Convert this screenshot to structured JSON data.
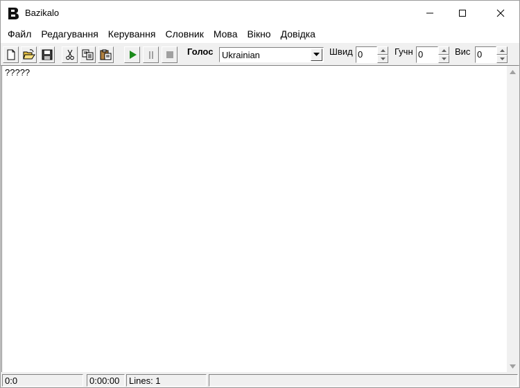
{
  "window": {
    "title": "Bazikalo"
  },
  "menu": {
    "items": [
      "Файл",
      "Редагування",
      "Керування",
      "Словник",
      "Мова",
      "Вікно",
      "Довідка"
    ]
  },
  "toolbar": {
    "voice_label": "Голос",
    "voice_selected": "Ukrainian",
    "speed_label": "Швид",
    "speed_value": "0",
    "volume_label": "Гучн",
    "volume_value": "0",
    "pitch_label": "Вис",
    "pitch_value": "0",
    "icons": [
      "new-file-icon",
      "open-folder-icon",
      "save-icon",
      "cut-icon",
      "copy-icon",
      "paste-icon",
      "play-icon",
      "pause-icon",
      "stop-icon"
    ]
  },
  "editor": {
    "content": "?????"
  },
  "status": {
    "position": "0:0",
    "time": "0:00:00",
    "lines": "Lines: 1"
  },
  "colors": {
    "play": "#1a8a1a",
    "chrome": "#f0f0f0"
  }
}
